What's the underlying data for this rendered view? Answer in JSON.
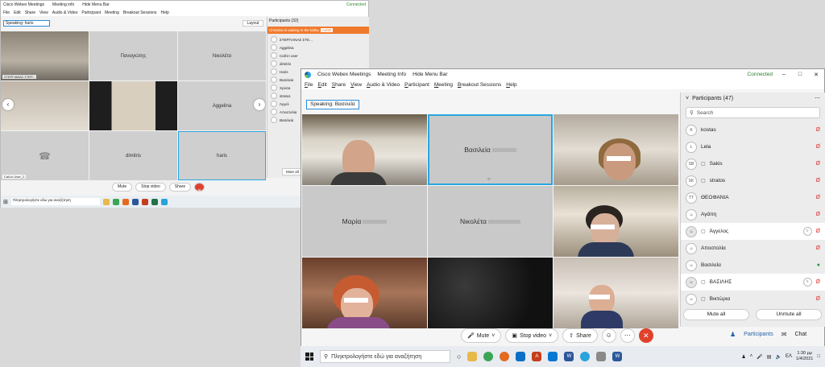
{
  "bg_window": {
    "title": "Cisco Webex Meetings",
    "meeting_info": "Meeting info",
    "hide_menu": "Hide Menu Bar",
    "status": "Connected",
    "menu": [
      "File",
      "Edit",
      "Share",
      "View",
      "Audio & Video",
      "Participant",
      "Meeting",
      "Breakout Sessions",
      "Help"
    ],
    "speaking": "Speaking: haris",
    "layout": "Layout",
    "tiles": [
      {
        "name": "ΣΤΕΡΓΙΑΝΑΣ ΣΤΕΡ..."
      },
      {
        "name": "Παναγιώτης"
      },
      {
        "name": "Νικολέτα"
      },
      {
        "name": ""
      },
      {
        "name": ""
      },
      {
        "name": "Aggelina"
      },
      {
        "name": "Call-in User_2"
      },
      {
        "name": "dimitris"
      },
      {
        "name": "haris"
      }
    ],
    "panel_title": "Participants (32)",
    "alert": "Christina is waiting in the lobby.",
    "admit": "Admit",
    "participants": [
      "ΣΤΕΡΓΙΑΝΑΣ ΣΤΕ...",
      "Aggelina",
      "Call-in user",
      "dimitris",
      "Haris",
      "Βασιλεία",
      "Χρύσα",
      "stratos",
      "Άγγελ",
      "Αποστολία",
      "Βασιλεία"
    ],
    "mute_all": "Mute all",
    "controls": [
      "Mute",
      "Stop video",
      "Share"
    ],
    "search": "Πληκτρολογήστε εδώ για αναζήτηση"
  },
  "main": {
    "title": "Cisco Webex Meetings",
    "meeting_info": "Meeting Info",
    "hide_menu": "Hide Menu Bar",
    "status": "Connected",
    "menu": [
      "File",
      "Edit",
      "Share",
      "View",
      "Audio & Video",
      "Participant",
      "Meeting",
      "Breakout Sessions",
      "Help"
    ],
    "speaking": "Speaking: Βασιλεία",
    "tiles": [
      {
        "name": ""
      },
      {
        "name": "Βασιλεία"
      },
      {
        "name": ""
      },
      {
        "name": "Μαρία"
      },
      {
        "name": "Νικολέτα"
      },
      {
        "name": ""
      },
      {
        "name": ""
      },
      {
        "name": ""
      },
      {
        "name": ""
      }
    ],
    "controls": {
      "mute": "Mute",
      "stop_video": "Stop video",
      "share": "Share"
    },
    "panel": {
      "title": "Participants (47)",
      "search_placeholder": "Search",
      "participants": [
        {
          "initials": "K",
          "name": "kostas",
          "status": "muted"
        },
        {
          "initials": "L",
          "name": "Lela",
          "status": "muted"
        },
        {
          "initials": "SB",
          "name": "Sakis",
          "status": "muted"
        },
        {
          "initials": "SK",
          "name": "stratos",
          "status": "muted"
        },
        {
          "initials": "TT",
          "name": "ΘΕΟΦΑΝΙΑ",
          "status": "muted"
        },
        {
          "initials": "",
          "name": "Αγάπη",
          "status": "muted"
        },
        {
          "initials": "",
          "name": "Άγγελος",
          "status": "muted"
        },
        {
          "initials": "",
          "name": "Αποστολία",
          "status": "muted"
        },
        {
          "initials": "",
          "name": "Βασιλεία",
          "status": "speaking"
        },
        {
          "initials": "",
          "name": "ΒΑΣΙΛΗΣ",
          "status": "muted"
        },
        {
          "initials": "",
          "name": "Βικτώρια",
          "status": "muted"
        }
      ],
      "mute_all": "Mute all",
      "unmute_all": "Unmute all",
      "participants_tab": "Participants",
      "chat_tab": "Chat"
    }
  },
  "taskbar": {
    "search": "Πληκτρολογήστε εδώ για αναζήτηση",
    "lang": "ΕΛ",
    "time": "1:30 μμ",
    "date": "1/4/2021"
  }
}
